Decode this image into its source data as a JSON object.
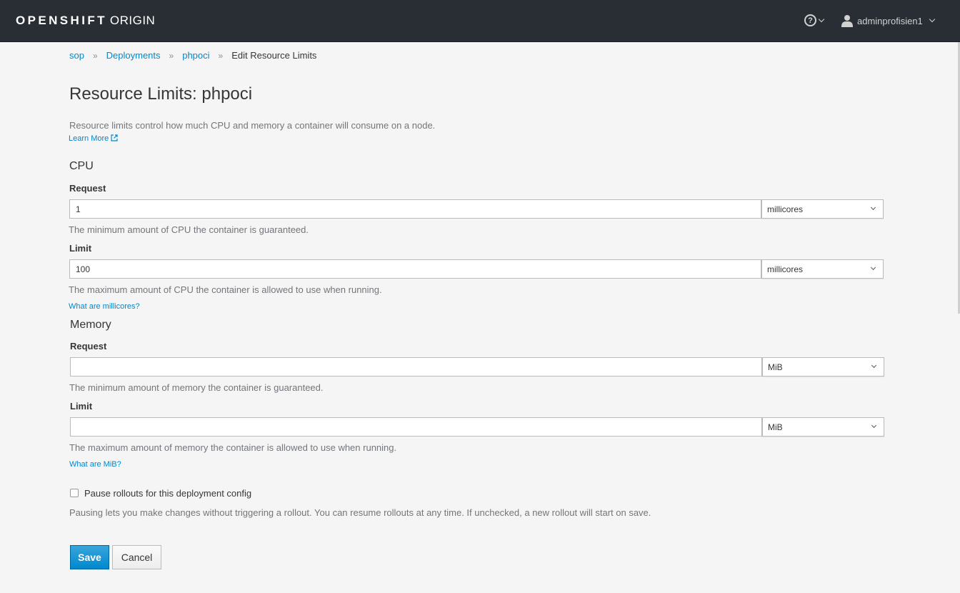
{
  "header": {
    "brand_bold": "OPENSHIFT",
    "brand_light": "ORIGIN",
    "help_glyph": "?",
    "username": "adminprofisien1"
  },
  "breadcrumb": {
    "items": [
      "sop",
      "Deployments",
      "phpoci"
    ],
    "current": "Edit Resource Limits"
  },
  "page": {
    "title": "Resource Limits: phpoci",
    "description": "Resource limits control how much CPU and memory a container will consume on a node.",
    "learn_more": "Learn More"
  },
  "cpu": {
    "heading": "CPU",
    "request": {
      "label": "Request",
      "value": "1",
      "unit": "millicores",
      "help": "The minimum amount of CPU the container is guaranteed."
    },
    "limit": {
      "label": "Limit",
      "value": "100",
      "unit": "millicores",
      "help": "The maximum amount of CPU the container is allowed to use when running."
    },
    "units_link": "What are millicores?"
  },
  "memory": {
    "heading": "Memory",
    "request": {
      "label": "Request",
      "value": "",
      "unit": "MiB",
      "help": "The minimum amount of memory the container is guaranteed."
    },
    "limit": {
      "label": "Limit",
      "value": "",
      "unit": "MiB",
      "help": "The maximum amount of memory the container is allowed to use when running."
    },
    "units_link": "What are MiB?"
  },
  "pause": {
    "label": "Pause rollouts for this deployment config",
    "checked": false,
    "help": "Pausing lets you make changes without triggering a rollout. You can resume rollouts at any time. If unchecked, a new rollout will start on save."
  },
  "actions": {
    "save": "Save",
    "cancel": "Cancel"
  },
  "colors": {
    "topbar": "#292e34",
    "link": "#0088ce",
    "primary": "#0088ce"
  }
}
